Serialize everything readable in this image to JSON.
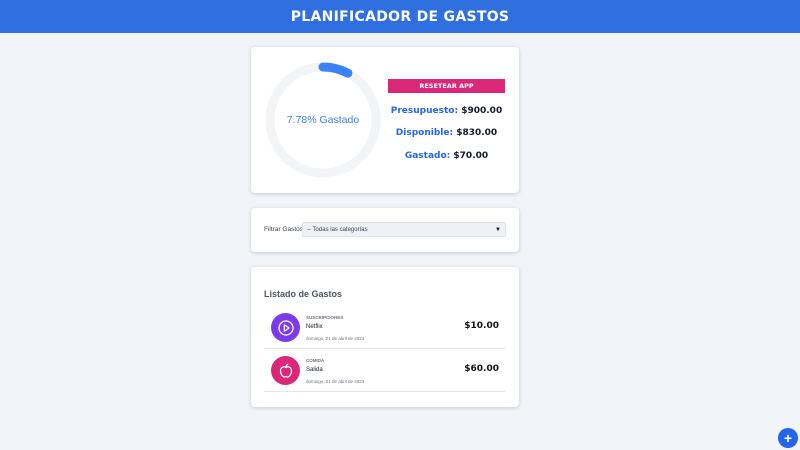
{
  "header": {
    "title": "PLANIFICADOR DE GASTOS"
  },
  "budget": {
    "progress_percent": 7.78,
    "progress_label": "7.78% Gastado",
    "reset_label": "RESETEAR APP",
    "presupuesto_label": "Presupuesto:",
    "presupuesto_value": "$900.00",
    "disponible_label": "Disponible:",
    "disponible_value": "$830.00",
    "gastado_label": "Gastado:",
    "gastado_value": "$70.00"
  },
  "filter": {
    "label": "Filtrar Gastos",
    "selected": "-- Todas las categorías"
  },
  "list": {
    "title": "Listado de Gastos",
    "expenses": [
      {
        "category": "SUSCRIPCIONES",
        "name": "Netflix",
        "date": "domingo, 21 de abril de 2024",
        "amount": "$10.00",
        "icon": "play-icon",
        "icon_color": "#7c3aed"
      },
      {
        "category": "COMIDA",
        "name": "Salida",
        "date": "domingo, 21 de abril de 2024",
        "amount": "$60.00",
        "icon": "apple-icon",
        "icon_color": "#db2777"
      }
    ]
  },
  "fab": {
    "label": "+"
  },
  "colors": {
    "header": "#2f6fe0",
    "accent": "#3b82f6",
    "reset": "#db2777"
  }
}
